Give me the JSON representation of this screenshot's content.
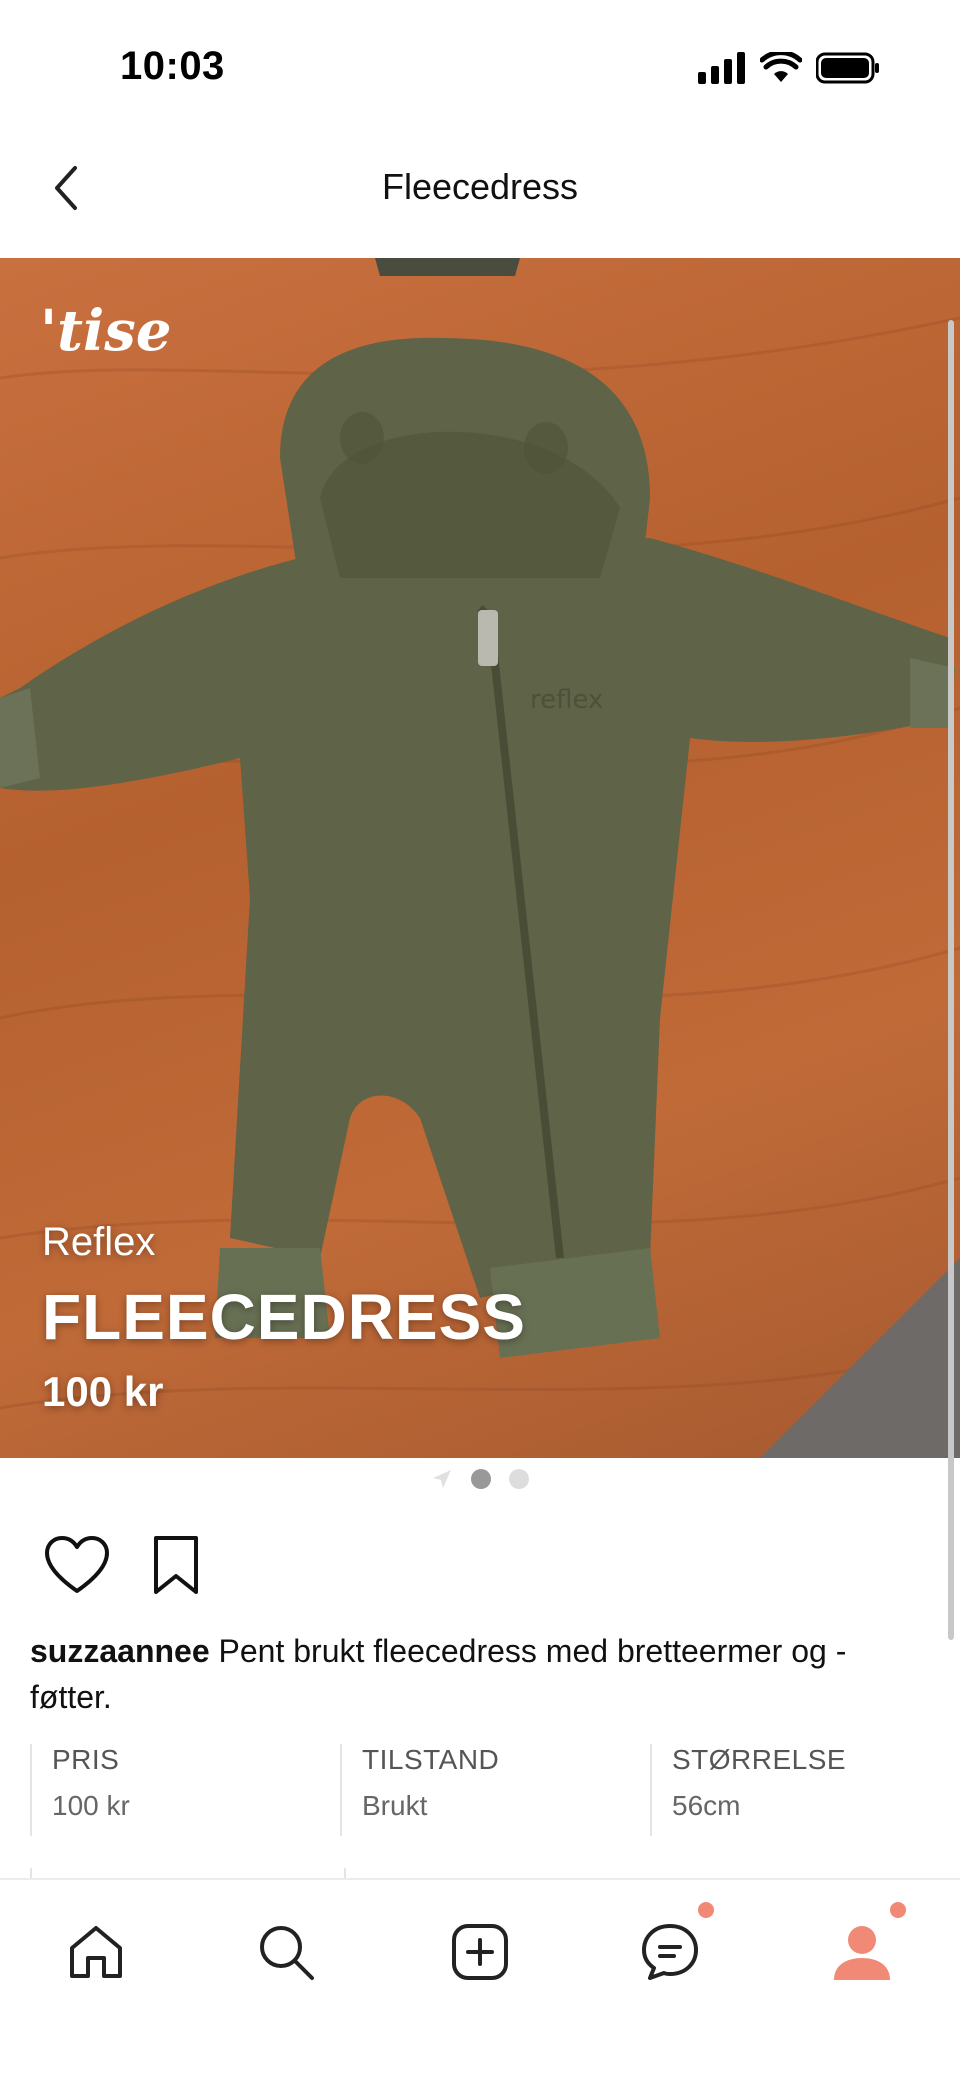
{
  "status_bar": {
    "time": "10:03"
  },
  "header": {
    "title": "Fleecedress"
  },
  "photo": {
    "logo": "'tise",
    "brand": "Reflex",
    "title": "FLEECEDRESS",
    "price": "100 kr"
  },
  "pager": {
    "count": 3,
    "active_index": 1
  },
  "listing": {
    "username": "suzzaannee",
    "description": " Pent brukt fleecedress med bretteermer og -føtter."
  },
  "details": [
    {
      "label": "PRIS",
      "value": "100 kr"
    },
    {
      "label": "TILSTAND",
      "value": "Brukt"
    },
    {
      "label": "STØRRELSE",
      "value": "56cm"
    }
  ],
  "icons": {
    "back": "chevron-left-icon",
    "like": "heart-icon",
    "save": "bookmark-icon",
    "nav": [
      "home-icon",
      "search-icon",
      "plus-icon",
      "chat-icon",
      "profile-icon"
    ]
  },
  "colors": {
    "accent": "#f08a76",
    "fleece": "#5f6347"
  }
}
